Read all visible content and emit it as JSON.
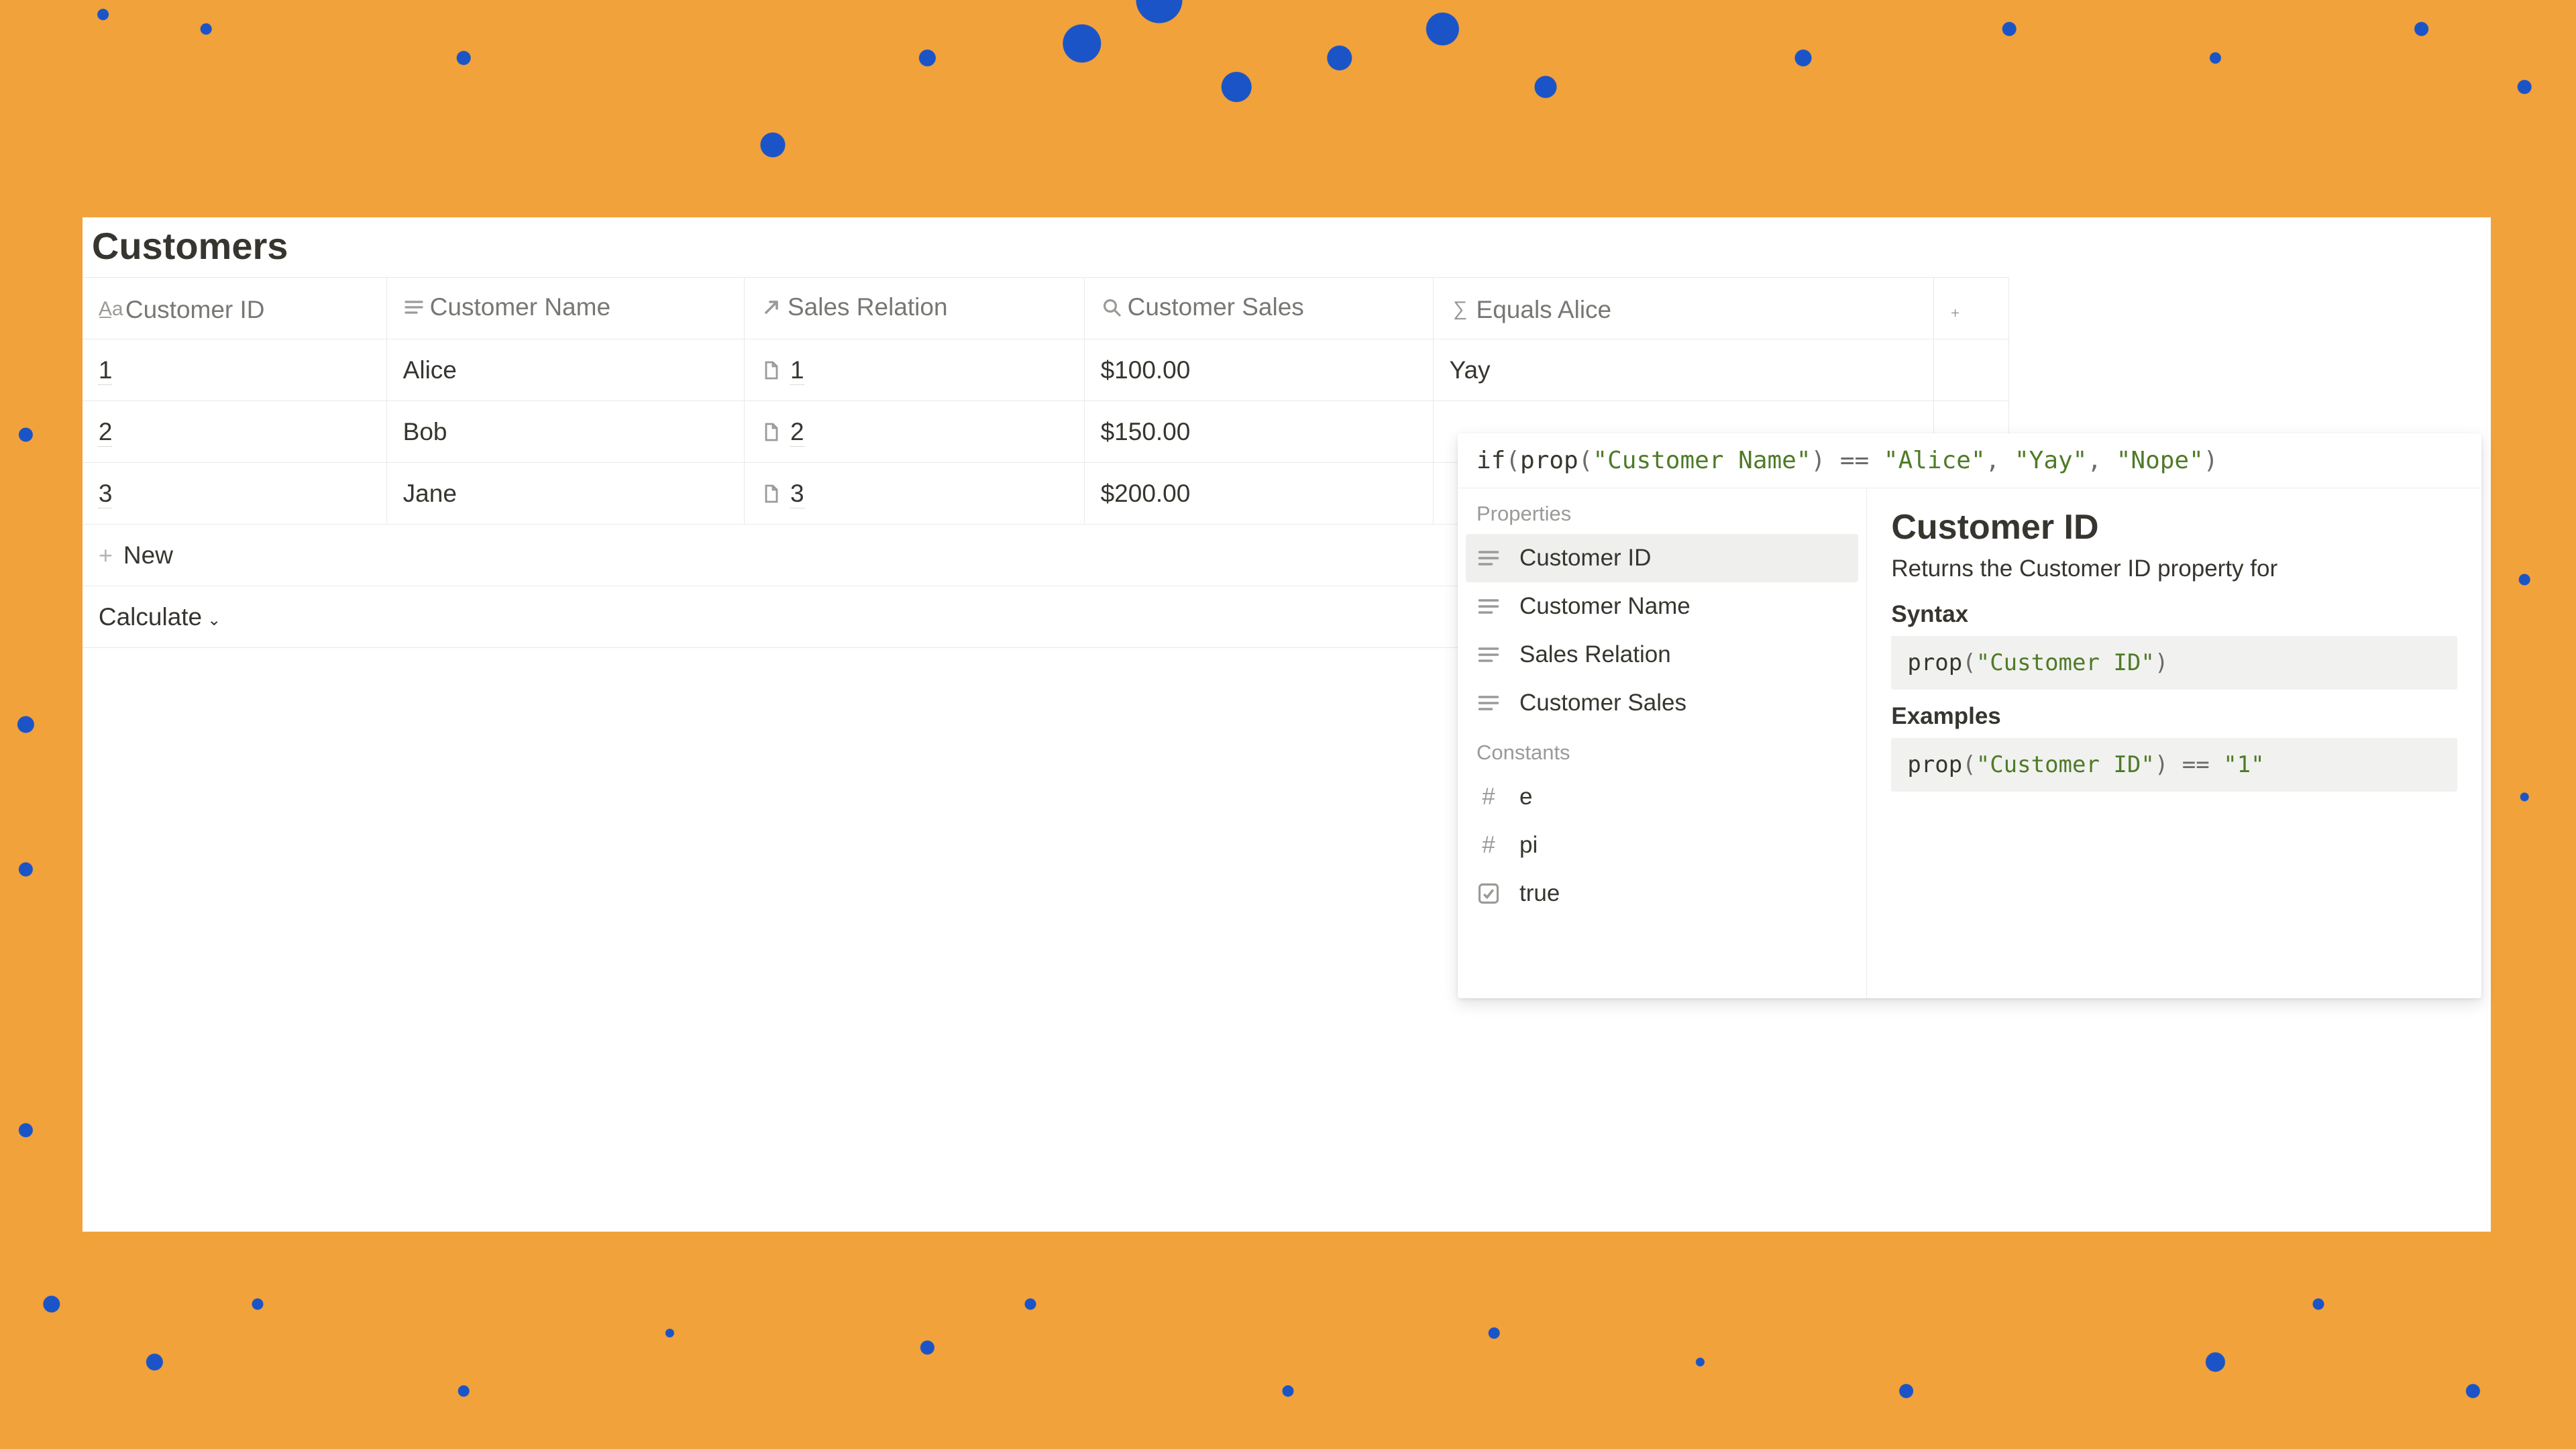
{
  "title": "Customers",
  "columns": {
    "id": {
      "label": "Customer ID",
      "icon": "text-aa-icon"
    },
    "name": {
      "label": "Customer Name",
      "icon": "text-lines-icon"
    },
    "rel": {
      "label": "Sales Relation",
      "icon": "relation-arrow-icon"
    },
    "sales": {
      "label": "Customer Sales",
      "icon": "rollup-search-icon"
    },
    "eq": {
      "label": "Equals Alice",
      "icon": "formula-sigma-icon"
    }
  },
  "rows": [
    {
      "id": "1",
      "name": "Alice",
      "rel": "1",
      "sales": "$100.00",
      "eq": "Yay"
    },
    {
      "id": "2",
      "name": "Bob",
      "rel": "2",
      "sales": "$150.00",
      "eq": ""
    },
    {
      "id": "3",
      "name": "Jane",
      "rel": "3",
      "sales": "$200.00",
      "eq": ""
    }
  ],
  "newRowLabel": "New",
  "calculateLabel": "Calculate",
  "formulaTokens": [
    {
      "t": "fn",
      "v": "if"
    },
    {
      "t": "op",
      "v": "("
    },
    {
      "t": "fn",
      "v": "prop"
    },
    {
      "t": "op",
      "v": "("
    },
    {
      "t": "str",
      "v": "\"Customer Name\""
    },
    {
      "t": "op",
      "v": ") == "
    },
    {
      "t": "str",
      "v": "\"Alice\""
    },
    {
      "t": "op",
      "v": ", "
    },
    {
      "t": "str",
      "v": "\"Yay\""
    },
    {
      "t": "op",
      "v": ", "
    },
    {
      "t": "str",
      "v": "\"Nope\""
    },
    {
      "t": "op",
      "v": ")"
    }
  ],
  "suggestions": {
    "propertiesLabel": "Properties",
    "properties": [
      {
        "label": "Customer ID",
        "icon": "text-lines-icon",
        "selected": true
      },
      {
        "label": "Customer Name",
        "icon": "text-lines-icon"
      },
      {
        "label": "Sales Relation",
        "icon": "text-lines-icon"
      },
      {
        "label": "Customer Sales",
        "icon": "text-lines-icon"
      }
    ],
    "constantsLabel": "Constants",
    "constants": [
      {
        "label": "e",
        "icon": "hash-icon"
      },
      {
        "label": "pi",
        "icon": "hash-icon"
      },
      {
        "label": "true",
        "icon": "checkbox-icon"
      }
    ]
  },
  "docs": {
    "title": "Customer ID",
    "description": "Returns the Customer ID property for",
    "syntaxLabel": "Syntax",
    "syntaxTokens": [
      {
        "t": "fn",
        "v": "prop"
      },
      {
        "t": "op",
        "v": "("
      },
      {
        "t": "str",
        "v": "\"Customer ID\""
      },
      {
        "t": "op",
        "v": ")"
      }
    ],
    "examplesLabel": "Examples",
    "exampleTokens": [
      {
        "t": "fn",
        "v": "prop"
      },
      {
        "t": "op",
        "v": "("
      },
      {
        "t": "str",
        "v": "\"Customer ID\""
      },
      {
        "t": "op",
        "v": ") "
      },
      {
        "t": "op",
        "v": "== "
      },
      {
        "t": "str",
        "v": "\"1\""
      }
    ]
  }
}
